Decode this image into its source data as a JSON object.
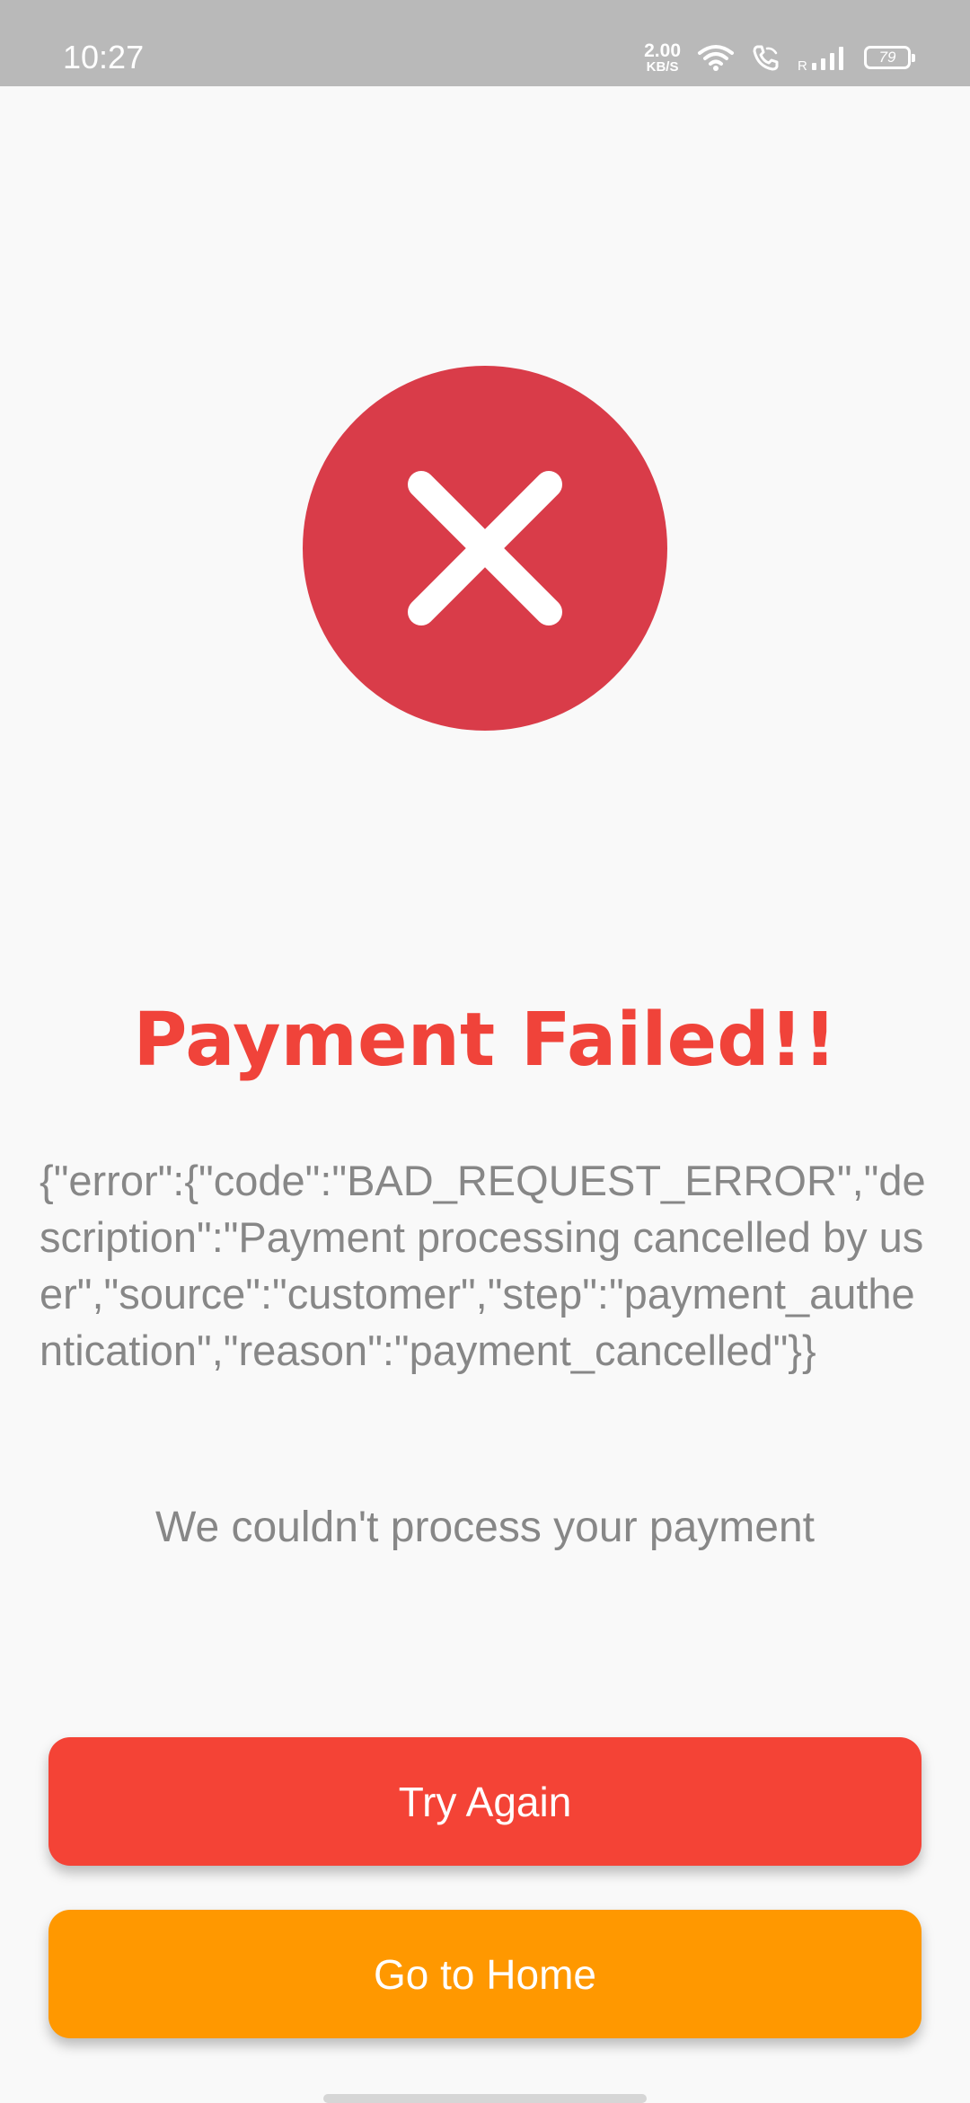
{
  "status_bar": {
    "time": "10:27",
    "net_speed_value": "2.00",
    "net_speed_unit": "KB/S",
    "signal_label": "R",
    "battery": "79",
    "icons": [
      "wifi-icon",
      "wifi-call-icon",
      "signal-icon",
      "battery-icon"
    ]
  },
  "status_icon": "close-icon",
  "colors": {
    "error_circle": "#d93c49",
    "title": "#f0433a",
    "try_again": "#f44336",
    "go_home": "#ff9800",
    "body_text": "#878787"
  },
  "title": "Payment Failed!!",
  "error_message": "{\"error\":{\"code\":\"BAD_REQUEST_ERROR\",\"description\":\"Payment processing cancelled by user\",\"source\":\"customer\",\"step\":\"payment_authentication\",\"reason\":\"payment_cancelled\"}}",
  "subtitle": "We couldn't process your payment",
  "buttons": {
    "try_again": "Try Again",
    "go_home": "Go to Home"
  }
}
